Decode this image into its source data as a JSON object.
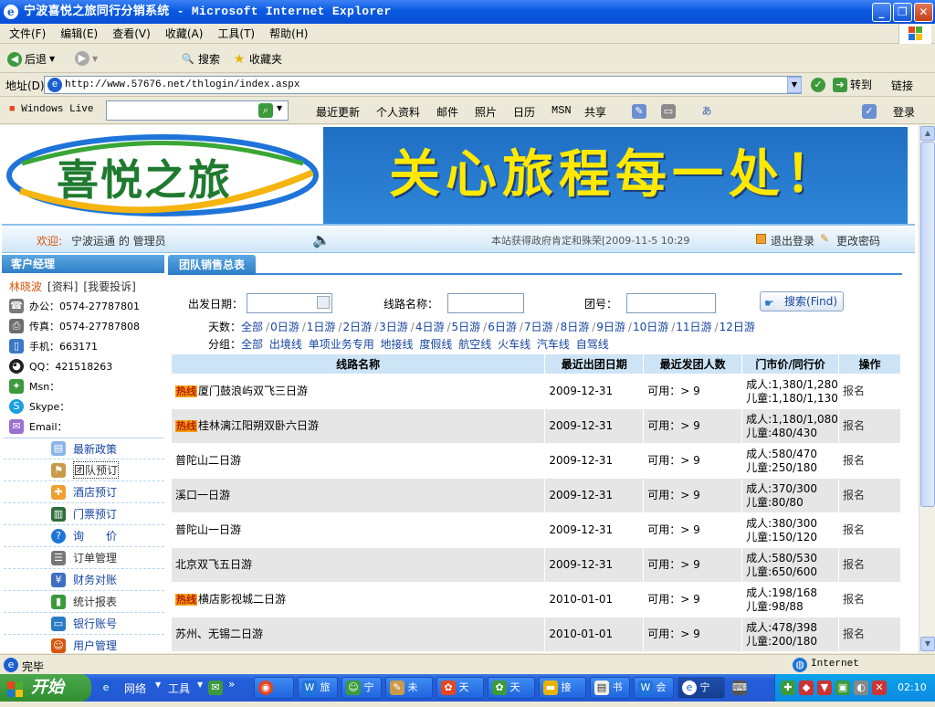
{
  "window": {
    "title": "宁波喜悦之旅同行分销系统 - Microsoft Internet Explorer"
  },
  "menu": [
    "文件(F)",
    "编辑(E)",
    "查看(V)",
    "收藏(A)",
    "工具(T)",
    "帮助(H)"
  ],
  "toolbar": {
    "back": "后退",
    "search": "搜索",
    "favorites": "收藏夹"
  },
  "address": {
    "label": "地址(D)",
    "url": "http://www.57676.net/thlogin/index.aspx",
    "go": "转到",
    "links": "链接"
  },
  "live": {
    "label": "Windows Live",
    "items": [
      "最近更新",
      "个人资料",
      "邮件",
      "照片",
      "日历",
      "MSN",
      "共享"
    ],
    "login": "登录"
  },
  "banner": {
    "logo_text": "喜悦之旅",
    "slogan": "关心旅程每一处！"
  },
  "welcome": {
    "greet": "欢迎:",
    "user": "宁波运通 的 管理员",
    "notice": "本站获得政府肯定和殊荣[2009-11-5 10:29",
    "logout": "退出登录",
    "change_pwd": "更改密码"
  },
  "sidebar": {
    "header": "客户经理",
    "manager": "林晓波",
    "info_link": "[资料]",
    "complain_link": "[我要投诉]",
    "office": "办公：0574-27787801",
    "fax": "传真：0574-27787808",
    "mobile": "手机：663171",
    "qq": "QQ：421518263",
    "msn": "Msn：",
    "skype": "Skype：",
    "email": "Email：",
    "menu": [
      "最新政策",
      "团队预订",
      "酒店预订",
      "门票预订",
      "询　　价",
      "订单管理",
      "财务对账",
      "统计报表",
      "银行账号",
      "用户管理"
    ]
  },
  "content": {
    "tab": "团队销售总表",
    "filters": {
      "depart_label": "出发日期：",
      "route_label": "线路名称：",
      "group_label": "团号：",
      "search_btn": "搜索(Find)",
      "days_label": "天数：",
      "days": [
        "全部",
        "0日游",
        "1日游",
        "2日游",
        "3日游",
        "4日游",
        "5日游",
        "6日游",
        "7日游",
        "8日游",
        "9日游",
        "10日游",
        "11日游",
        "12日游"
      ],
      "group_kind_label": "分组：",
      "group_kinds": [
        "全部",
        "出境线",
        "单项业务专用",
        "地接线",
        "度假线",
        "航空线",
        "火车线",
        "汽车线",
        "自驾线"
      ]
    },
    "table": {
      "headers": [
        "线路名称",
        "最近出团日期",
        "最近发团人数",
        "门市价/同行价",
        "操作"
      ],
      "hot_label": "热线",
      "rows": [
        {
          "hot": true,
          "name": "厦门鼓浪屿双飞三日游",
          "date": "2009-12-31",
          "count": "可用：> 9",
          "adult": "成人:1,380/1,280",
          "child": "儿童:1,180/1,130",
          "op": "报名"
        },
        {
          "hot": true,
          "name": "桂林漓江阳朔双卧六日游",
          "date": "2009-12-31",
          "count": "可用：> 9",
          "adult": "成人:1,180/1,080",
          "child": "儿童:480/430",
          "op": "报名"
        },
        {
          "hot": false,
          "name": "普陀山二日游",
          "date": "2009-12-31",
          "count": "可用：> 9",
          "adult": "成人:580/470",
          "child": "儿童:250/180",
          "op": "报名"
        },
        {
          "hot": false,
          "name": "溪口一日游",
          "date": "2009-12-31",
          "count": "可用：> 9",
          "adult": "成人:370/300",
          "child": "儿童:80/80",
          "op": "报名"
        },
        {
          "hot": false,
          "name": "普陀山一日游",
          "date": "2009-12-31",
          "count": "可用：> 9",
          "adult": "成人:380/300",
          "child": "儿童:150/120",
          "op": "报名"
        },
        {
          "hot": false,
          "name": "北京双飞五日游",
          "date": "2009-12-31",
          "count": "可用：> 9",
          "adult": "成人:580/530",
          "child": "儿童:650/600",
          "op": "报名"
        },
        {
          "hot": true,
          "name": "横店影视城二日游",
          "date": "2010-01-01",
          "count": "可用：> 9",
          "adult": "成人:198/168",
          "child": "儿童:98/88",
          "op": "报名"
        },
        {
          "hot": false,
          "name": "苏州、无锡二日游",
          "date": "2010-01-01",
          "count": "可用：> 9",
          "adult": "成人:478/398",
          "child": "儿童:200/180",
          "op": "报名"
        }
      ]
    }
  },
  "status": {
    "text": "完毕",
    "zone": "Internet"
  },
  "taskbar": {
    "start": "开始",
    "network": "网络",
    "tools": "工具",
    "tasks": [
      "",
      "旅",
      "宁",
      "未",
      "天",
      "天",
      "接",
      "书",
      "会",
      "宁"
    ],
    "clock": "02:10"
  },
  "colors": {
    "accent": "#2e7fc8",
    "tab": "#3b8ad4",
    "link": "#1746a0",
    "hot": "#f5a011"
  }
}
